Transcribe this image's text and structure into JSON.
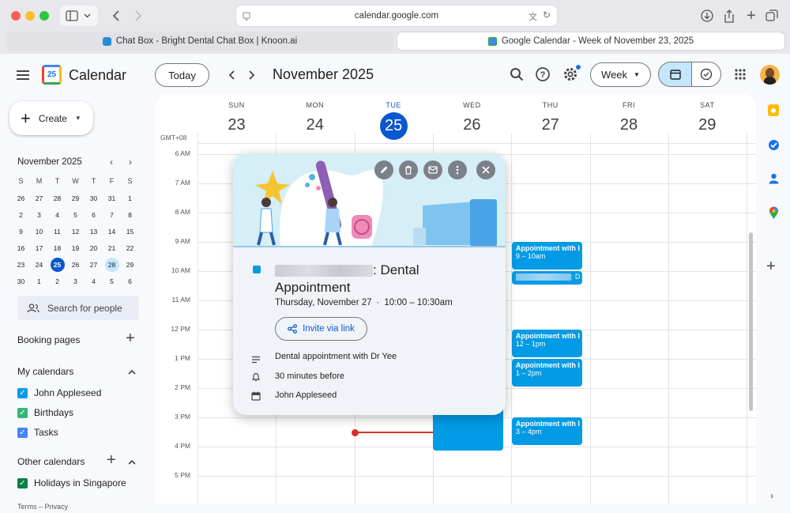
{
  "browser": {
    "url": "calendar.google.com",
    "tabs": [
      {
        "label": "Chat Box - Bright Dental Chat Box | Knoon.ai",
        "active": false
      },
      {
        "label": "Google Calendar - Week of November 23, 2025",
        "active": true
      }
    ]
  },
  "header": {
    "logo_day": "25",
    "app_name": "Calendar",
    "today_label": "Today",
    "month_title": "November 2025",
    "view_label": "Week"
  },
  "sidebar": {
    "create_label": "Create",
    "mini_title": "November 2025",
    "mini_weekdays": [
      "S",
      "M",
      "T",
      "W",
      "T",
      "F",
      "S"
    ],
    "mini_days": [
      [
        "26",
        "27",
        "28",
        "29",
        "30",
        "31",
        "1"
      ],
      [
        "2",
        "3",
        "4",
        "5",
        "6",
        "7",
        "8"
      ],
      [
        "9",
        "10",
        "11",
        "12",
        "13",
        "14",
        "15"
      ],
      [
        "16",
        "17",
        "18",
        "19",
        "20",
        "21",
        "22"
      ],
      [
        "23",
        "24",
        "25",
        "26",
        "27",
        "28",
        "29"
      ],
      [
        "30",
        "1",
        "2",
        "3",
        "4",
        "5",
        "6"
      ]
    ],
    "search_placeholder": "Search for people",
    "booking_pages": "Booking pages",
    "my_calendars_title": "My calendars",
    "my_calendars": [
      {
        "name": "John Appleseed",
        "color": "#039be5"
      },
      {
        "name": "Birthdays",
        "color": "#33b679"
      },
      {
        "name": "Tasks",
        "color": "#4285f4"
      }
    ],
    "other_calendars_title": "Other calendars",
    "other_calendars": [
      {
        "name": "Holidays in Singapore",
        "color": "#0b8043"
      }
    ],
    "footer": "Terms – Privacy"
  },
  "week": {
    "timezone": "GMT+08",
    "days": [
      {
        "name": "SUN",
        "num": "23"
      },
      {
        "name": "MON",
        "num": "24"
      },
      {
        "name": "TUE",
        "num": "25"
      },
      {
        "name": "WED",
        "num": "26"
      },
      {
        "name": "THU",
        "num": "27"
      },
      {
        "name": "FRI",
        "num": "28"
      },
      {
        "name": "SAT",
        "num": "29"
      }
    ],
    "hours": [
      "6 AM",
      "7 AM",
      "8 AM",
      "9 AM",
      "10 AM",
      "11 AM",
      "12 PM",
      "1 PM",
      "2 PM",
      "3 PM",
      "4 PM",
      "5 PM"
    ]
  },
  "events": [
    {
      "title": "Appointment with I",
      "time": "9 – 10am"
    },
    {
      "title": "",
      "time": ": D"
    },
    {
      "title": "Appointment with I",
      "time": "12 – 1pm"
    },
    {
      "title": "Appointment with I",
      "time": "1 – 2pm"
    },
    {
      "title": "Appointment with I",
      "time": "3 – 4pm"
    }
  ],
  "popup": {
    "title_suffix": ": Dental",
    "title_line2": "Appointment",
    "date_text": "Thursday, November 27",
    "time_text": "10:00 – 10:30am",
    "invite_label": "Invite via link",
    "description": "Dental appointment with Dr Yee",
    "reminder": "30 minutes before",
    "calendar_name": "John Appleseed",
    "color": "#039be5"
  },
  "colors": {
    "accent": "#0b57d0",
    "event": "#039be5",
    "now_line": "#d93025"
  }
}
